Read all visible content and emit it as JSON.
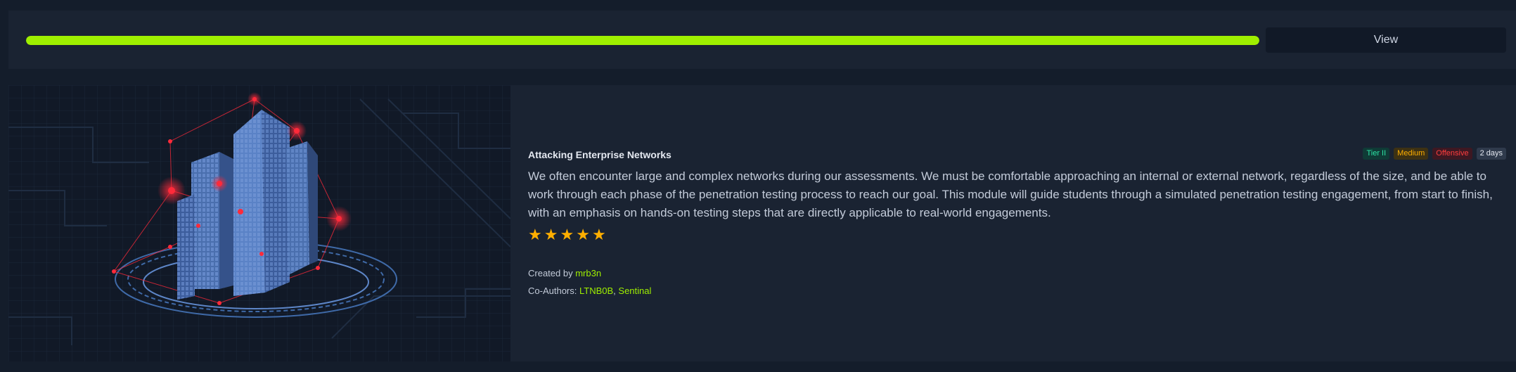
{
  "progress": {
    "percent": 100,
    "view_label": "View"
  },
  "module": {
    "title": "Attacking Enterprise Networks",
    "badges": [
      {
        "label": "Tier II",
        "kind": "tier"
      },
      {
        "label": "Medium",
        "kind": "diff"
      },
      {
        "label": "Offensive",
        "kind": "cat"
      },
      {
        "label": "2 days",
        "kind": "dur"
      }
    ],
    "description": "We often encounter large and complex networks during our assessments. We must be comfortable approaching an internal or external network, regardless of the size, and be able to work through each phase of the penetration testing process to reach our goal. This module will guide students through a simulated penetration testing engagement, from start to finish, with an emphasis on hands-on testing steps that are directly applicable to real-world engagements.",
    "rating": {
      "value": 5,
      "max": 5,
      "icon": "star-icon"
    },
    "created_by_label": "Created by",
    "creator": "mrb3n",
    "coauthors_label": "Co-Authors:",
    "coauthors": [
      "LTNB0B",
      "Sentinal"
    ],
    "image_icon": "isometric-building-network-illustration"
  },
  "colors": {
    "accent": "#9fef00",
    "page_bg": "#141d2b",
    "card_bg": "#1a2332",
    "star": "#ffaf00",
    "node_red": "#ff2a3a"
  }
}
